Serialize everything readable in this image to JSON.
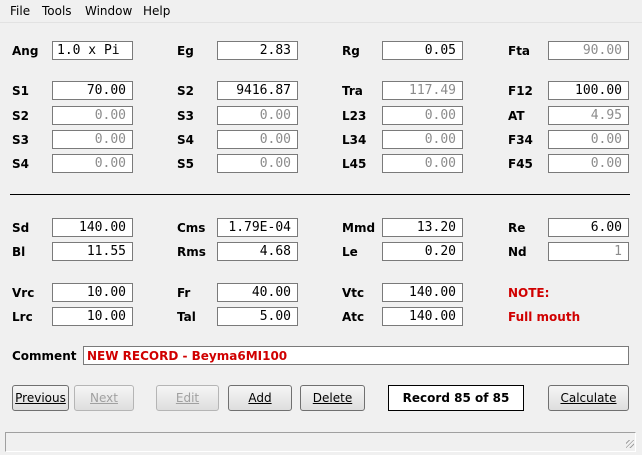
{
  "menu": {
    "file": "File",
    "tools": "Tools",
    "window": "Window",
    "help": "Help"
  },
  "params": {
    "ang": {
      "label": "Ang",
      "value": "1.0 x Pi"
    },
    "eg": {
      "label": "Eg",
      "value": "2.83"
    },
    "rg": {
      "label": "Rg",
      "value": "0.05"
    },
    "fta": {
      "label": "Fta",
      "value": "90.00"
    },
    "s1": {
      "label": "S1",
      "value": "70.00"
    },
    "s2a": {
      "label": "S2",
      "value": "0.00"
    },
    "s3a": {
      "label": "S3",
      "value": "0.00"
    },
    "s4a": {
      "label": "S4",
      "value": "0.00"
    },
    "s2b": {
      "label": "S2",
      "value": "9416.87"
    },
    "s3b": {
      "label": "S3",
      "value": "0.00"
    },
    "s4b": {
      "label": "S4",
      "value": "0.00"
    },
    "s5": {
      "label": "S5",
      "value": "0.00"
    },
    "tra": {
      "label": "Tra",
      "value": "117.49"
    },
    "l23": {
      "label": "L23",
      "value": "0.00"
    },
    "l34": {
      "label": "L34",
      "value": "0.00"
    },
    "l45": {
      "label": "L45",
      "value": "0.00"
    },
    "f12": {
      "label": "F12",
      "value": "100.00"
    },
    "at": {
      "label": "AT",
      "value": "4.95"
    },
    "f34": {
      "label": "F34",
      "value": "0.00"
    },
    "f45": {
      "label": "F45",
      "value": "0.00"
    },
    "sd": {
      "label": "Sd",
      "value": "140.00"
    },
    "bl": {
      "label": "Bl",
      "value": "11.55"
    },
    "cms": {
      "label": "Cms",
      "value": "1.79E-04"
    },
    "rms": {
      "label": "Rms",
      "value": "4.68"
    },
    "mmd": {
      "label": "Mmd",
      "value": "13.20"
    },
    "le": {
      "label": "Le",
      "value": "0.20"
    },
    "re": {
      "label": "Re",
      "value": "6.00"
    },
    "nd": {
      "label": "Nd",
      "value": "1"
    },
    "vrc": {
      "label": "Vrc",
      "value": "10.00"
    },
    "lrc": {
      "label": "Lrc",
      "value": "10.00"
    },
    "fr": {
      "label": "Fr",
      "value": "40.00"
    },
    "tal": {
      "label": "Tal",
      "value": "5.00"
    },
    "vtc": {
      "label": "Vtc",
      "value": "140.00"
    },
    "atc": {
      "label": "Atc",
      "value": "140.00"
    }
  },
  "note": {
    "title": "NOTE:",
    "text": "Full mouth"
  },
  "comment": {
    "label": "Comment",
    "value": "NEW RECORD - Beyma6MI100"
  },
  "buttons": {
    "previous": "Previous",
    "next": "Next",
    "edit": "Edit",
    "add": "Add",
    "delete": "Delete",
    "calculate": "Calculate"
  },
  "record": "Record 85 of 85",
  "colors": {
    "note_red": "#d00000",
    "disabled_text": "#8c8c8c"
  }
}
